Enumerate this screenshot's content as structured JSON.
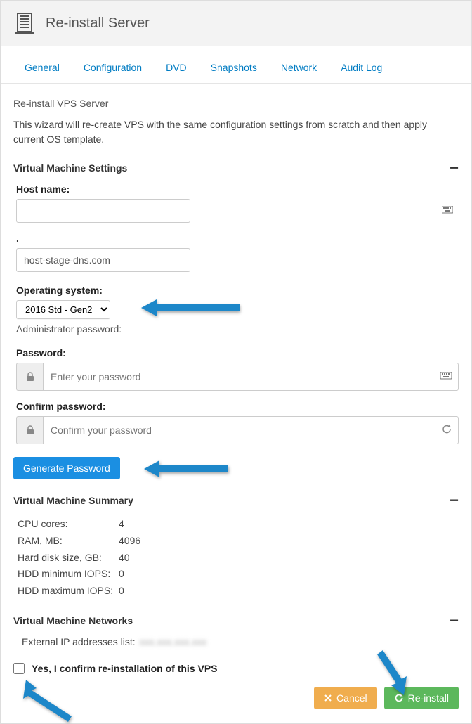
{
  "header": {
    "title": "Re-install Server"
  },
  "tabs": [
    "General",
    "Configuration",
    "DVD",
    "Snapshots",
    "Network",
    "Audit Log"
  ],
  "main": {
    "subtitle": "Re-install VPS Server",
    "desc": "This wizard will re-create VPS with the same configuration settings from scratch and then apply current OS template."
  },
  "vm_settings": {
    "heading": "Virtual Machine Settings",
    "hostname_label": "Host name:",
    "hostname_value": "",
    "dot_label": ".",
    "dns_value": "host-stage-dns.com",
    "os_label": "Operating system:",
    "os_value": "2016 Std - Gen2",
    "admin_note": "Administrator password:",
    "password_label": "Password:",
    "password_placeholder": "Enter your password",
    "confirm_label": "Confirm password:",
    "confirm_placeholder": "Confirm your password",
    "gen_btn": "Generate Password"
  },
  "vm_summary": {
    "heading": "Virtual Machine Summary",
    "rows": [
      {
        "k": "CPU cores:",
        "v": "4"
      },
      {
        "k": "RAM, MB:",
        "v": "4096"
      },
      {
        "k": "Hard disk size, GB:",
        "v": "40"
      },
      {
        "k": "HDD minimum IOPS:",
        "v": "0"
      },
      {
        "k": "HDD maximum IOPS:",
        "v": "0"
      }
    ]
  },
  "vm_networks": {
    "heading": "Virtual Machine Networks",
    "ext_ip_label": "External IP addresses list:",
    "ext_ip_value": "xxx.xxx.xxx.xxx"
  },
  "confirm": {
    "label": "Yes, I confirm re-installation of this VPS"
  },
  "actions": {
    "cancel": "Cancel",
    "reinstall": "Re-install"
  },
  "colors": {
    "link": "#007cc3",
    "primary": "#1b8fe2",
    "warning": "#f0ad4e",
    "success": "#5cb85c",
    "arrow": "#1d87c9"
  }
}
